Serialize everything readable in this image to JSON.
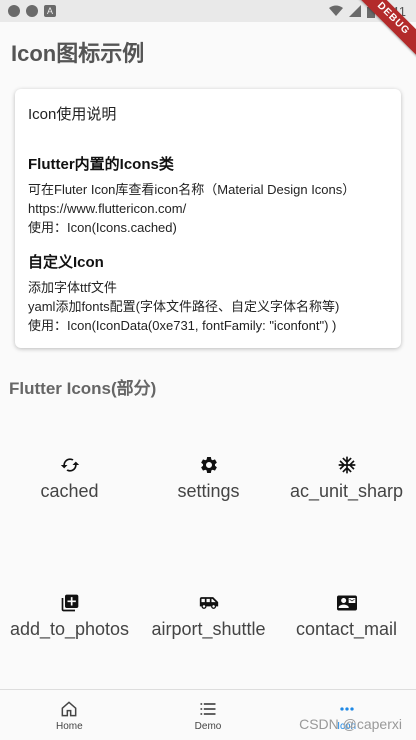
{
  "status_bar": {
    "time": "1:41"
  },
  "debug_banner": "DEBUG",
  "page_title": "Icon图标示例",
  "card": {
    "title": "Icon使用说明",
    "builtin": {
      "heading": "Flutter内置的Icons类",
      "lines": [
        "可在Fluter Icon库查看icon名称（Material Design Icons）",
        "https://www.fluttericon.com/",
        "使用：Icon(Icons.cached)"
      ]
    },
    "custom": {
      "heading": "自定义Icon",
      "lines": [
        "添加字体ttf文件",
        "yaml添加fonts配置(字体文件路径、自定义字体名称等)",
        "使用：Icon(IconData(0xe731, fontFamily: \"iconfont\") )"
      ]
    }
  },
  "section_heading": "Flutter Icons(部分)",
  "icons": [
    {
      "label": "cached",
      "icon": "cached-icon"
    },
    {
      "label": "settings",
      "icon": "settings-icon"
    },
    {
      "label": "ac_unit_sharp",
      "icon": "ac-unit-icon"
    },
    {
      "label": "add_to_photos",
      "icon": "add-to-photos-icon"
    },
    {
      "label": "airport_shuttle",
      "icon": "airport-shuttle-icon"
    },
    {
      "label": "contact_mail",
      "icon": "contact-mail-icon"
    }
  ],
  "nav": {
    "items": [
      {
        "label": "Home",
        "icon": "home-icon"
      },
      {
        "label": "Demo",
        "icon": "list-icon"
      },
      {
        "label": "Icon",
        "icon": "more-horiz-icon"
      }
    ],
    "active_color": "#1e88e5"
  },
  "watermark": "CSDN @caperxi"
}
